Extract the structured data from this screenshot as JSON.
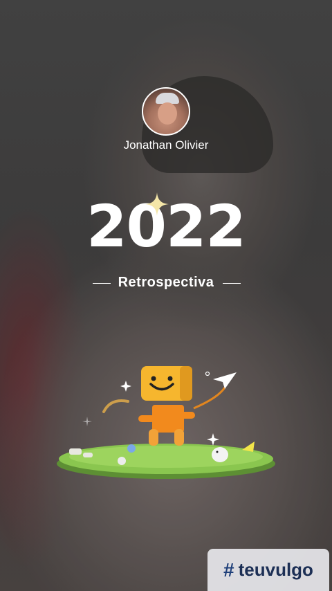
{
  "profile": {
    "name": "Jonathan Olivier"
  },
  "hero": {
    "year": "2022",
    "subtitle": "Retrospectiva"
  },
  "watermark": {
    "hash": "#",
    "brand": "teuvulgo"
  },
  "colors": {
    "text": "#ffffff",
    "watermark_bg": "#e6e6eb",
    "watermark_text": "#1c2f55"
  }
}
